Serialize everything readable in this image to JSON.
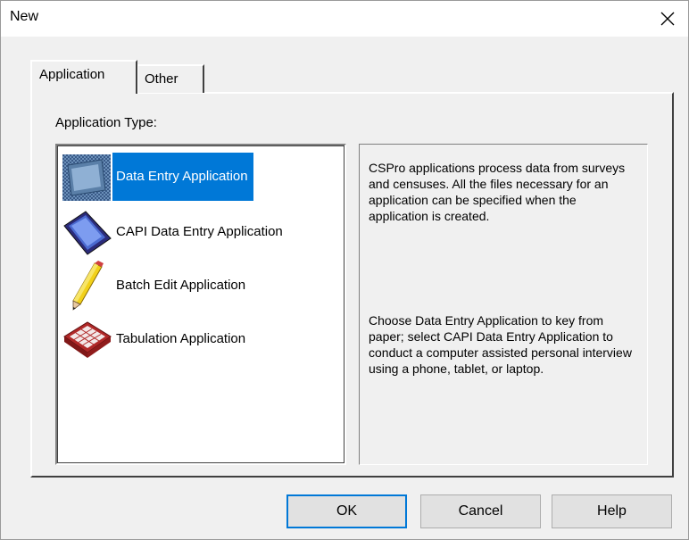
{
  "window": {
    "title": "New"
  },
  "tabs": [
    {
      "label": "Application",
      "selected": true
    },
    {
      "label": "Other",
      "selected": false
    }
  ],
  "application_type": {
    "label": "Application Type:",
    "items": [
      {
        "label": "Data Entry Application",
        "icon": "data-entry-icon",
        "selected": true
      },
      {
        "label": "CAPI Data Entry Application",
        "icon": "tablet-icon",
        "selected": false
      },
      {
        "label": "Batch Edit Application",
        "icon": "pencil-icon",
        "selected": false
      },
      {
        "label": "Tabulation Application",
        "icon": "table-icon",
        "selected": false
      }
    ]
  },
  "description": {
    "paragraph1": "CSPro applications process data from surveys and censuses. All the files necessary for an application can be specified when the application is created.",
    "paragraph2": "Choose Data Entry Application to key from paper; select CAPI Data Entry Application to conduct a computer assisted personal interview using a phone, tablet, or laptop."
  },
  "buttons": {
    "ok": "OK",
    "cancel": "Cancel",
    "help": "Help"
  },
  "colors": {
    "selection": "#0078d7",
    "background": "#f0f0f0"
  }
}
